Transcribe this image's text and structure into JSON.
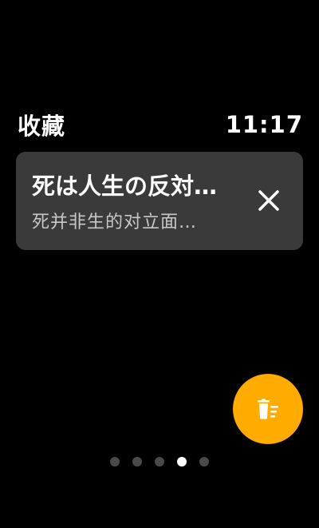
{
  "header": {
    "title": "收藏",
    "time": "11:17"
  },
  "favorites": [
    {
      "title": "死は人生の反対…",
      "subtitle": "死并非生的对立面…",
      "action_icon": "close-icon"
    }
  ],
  "fab": {
    "icon": "clear-list-icon",
    "color": "#ffab00"
  },
  "pager": {
    "count": 5,
    "active_index": 3
  },
  "colors": {
    "background": "#000000",
    "card": "#3a3a3a",
    "accent": "#ffab00",
    "dot_inactive": "#4a4a4a",
    "dot_active": "#ffffff"
  }
}
